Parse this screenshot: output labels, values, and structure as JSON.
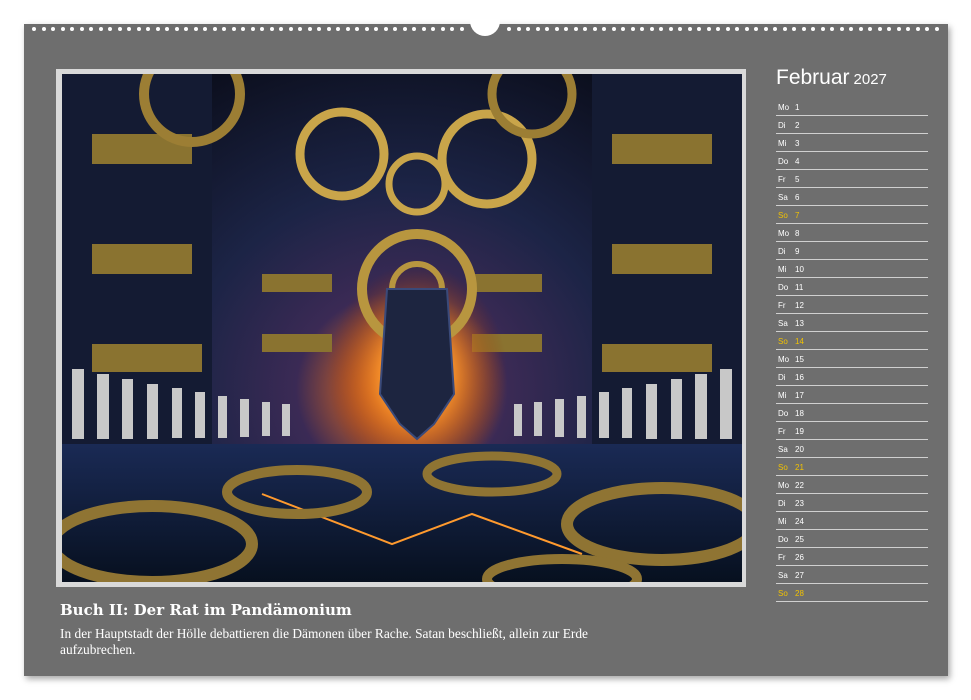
{
  "calendar": {
    "month": "Februar",
    "year": "2027",
    "days": [
      {
        "weekday": "Mo",
        "day": "1",
        "sunday": false
      },
      {
        "weekday": "Di",
        "day": "2",
        "sunday": false
      },
      {
        "weekday": "Mi",
        "day": "3",
        "sunday": false
      },
      {
        "weekday": "Do",
        "day": "4",
        "sunday": false
      },
      {
        "weekday": "Fr",
        "day": "5",
        "sunday": false
      },
      {
        "weekday": "Sa",
        "day": "6",
        "sunday": false
      },
      {
        "weekday": "So",
        "day": "7",
        "sunday": true
      },
      {
        "weekday": "Mo",
        "day": "8",
        "sunday": false
      },
      {
        "weekday": "Di",
        "day": "9",
        "sunday": false
      },
      {
        "weekday": "Mi",
        "day": "10",
        "sunday": false
      },
      {
        "weekday": "Do",
        "day": "11",
        "sunday": false
      },
      {
        "weekday": "Fr",
        "day": "12",
        "sunday": false
      },
      {
        "weekday": "Sa",
        "day": "13",
        "sunday": false
      },
      {
        "weekday": "So",
        "day": "14",
        "sunday": true
      },
      {
        "weekday": "Mo",
        "day": "15",
        "sunday": false
      },
      {
        "weekday": "Di",
        "day": "16",
        "sunday": false
      },
      {
        "weekday": "Mi",
        "day": "17",
        "sunday": false
      },
      {
        "weekday": "Do",
        "day": "18",
        "sunday": false
      },
      {
        "weekday": "Fr",
        "day": "19",
        "sunday": false
      },
      {
        "weekday": "Sa",
        "day": "20",
        "sunday": false
      },
      {
        "weekday": "So",
        "day": "21",
        "sunday": true
      },
      {
        "weekday": "Mo",
        "day": "22",
        "sunday": false
      },
      {
        "weekday": "Di",
        "day": "23",
        "sunday": false
      },
      {
        "weekday": "Mi",
        "day": "24",
        "sunday": false
      },
      {
        "weekday": "Do",
        "day": "25",
        "sunday": false
      },
      {
        "weekday": "Fr",
        "day": "26",
        "sunday": false
      },
      {
        "weekday": "Sa",
        "day": "27",
        "sunday": false
      },
      {
        "weekday": "So",
        "day": "28",
        "sunday": true
      }
    ]
  },
  "caption": {
    "title": "Buch II: Der Rat im Pandämonium",
    "text": "In der Hauptstadt der Hölle debattieren die Dämonen über Rache. Satan beschließt, allein zur Erde aufzubrechen."
  },
  "colors": {
    "page_background": "#6e6e6e",
    "sunday_highlight": "#f2c200",
    "text": "#ffffff"
  }
}
